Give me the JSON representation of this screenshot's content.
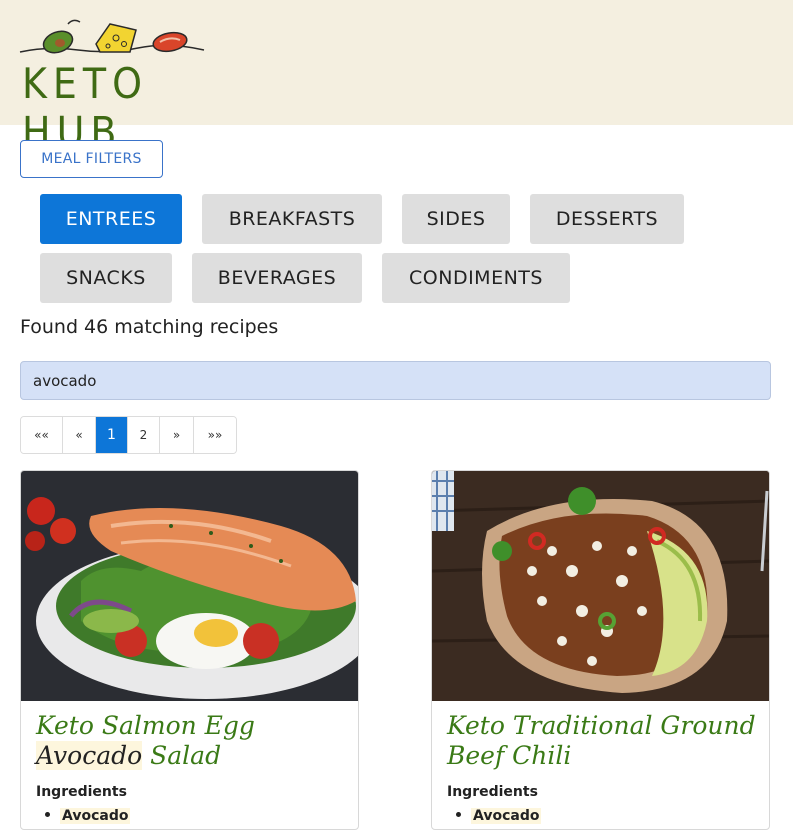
{
  "brand": {
    "name": "KETO HUB"
  },
  "filters": {
    "label": "MEAL FILTERS"
  },
  "categories": [
    {
      "label": "ENTREES",
      "active": true
    },
    {
      "label": "BREAKFASTS",
      "active": false
    },
    {
      "label": "SIDES",
      "active": false
    },
    {
      "label": "DESSERTS",
      "active": false
    },
    {
      "label": "SNACKS",
      "active": false
    },
    {
      "label": "BEVERAGES",
      "active": false
    },
    {
      "label": "CONDIMENTS",
      "active": false
    }
  ],
  "results": {
    "text": "Found 46 matching recipes"
  },
  "search": {
    "value": "avocado"
  },
  "pagination": {
    "first": "««",
    "prev": "«",
    "pages": [
      "1",
      "2"
    ],
    "current": "1",
    "next": "»",
    "last": "»»"
  },
  "recipes": [
    {
      "title_before": "Keto Salmon Egg ",
      "title_highlight": "Avocado",
      "title_after": " Salad",
      "ingredients_label": "Ingredients",
      "ingredients": [
        "Avocado"
      ]
    },
    {
      "title_before": "Keto Traditional Ground Beef Chili",
      "title_highlight": "",
      "title_after": "",
      "ingredients_label": "Ingredients",
      "ingredients": [
        "Avocado"
      ]
    }
  ],
  "colors": {
    "header_bg": "#f4efe0",
    "brand_green": "#3f6a14",
    "accent_blue": "#0d76d8",
    "title_green": "#3a7a16",
    "highlight": "#fdf6dd",
    "search_bg": "#d5e1f7"
  }
}
